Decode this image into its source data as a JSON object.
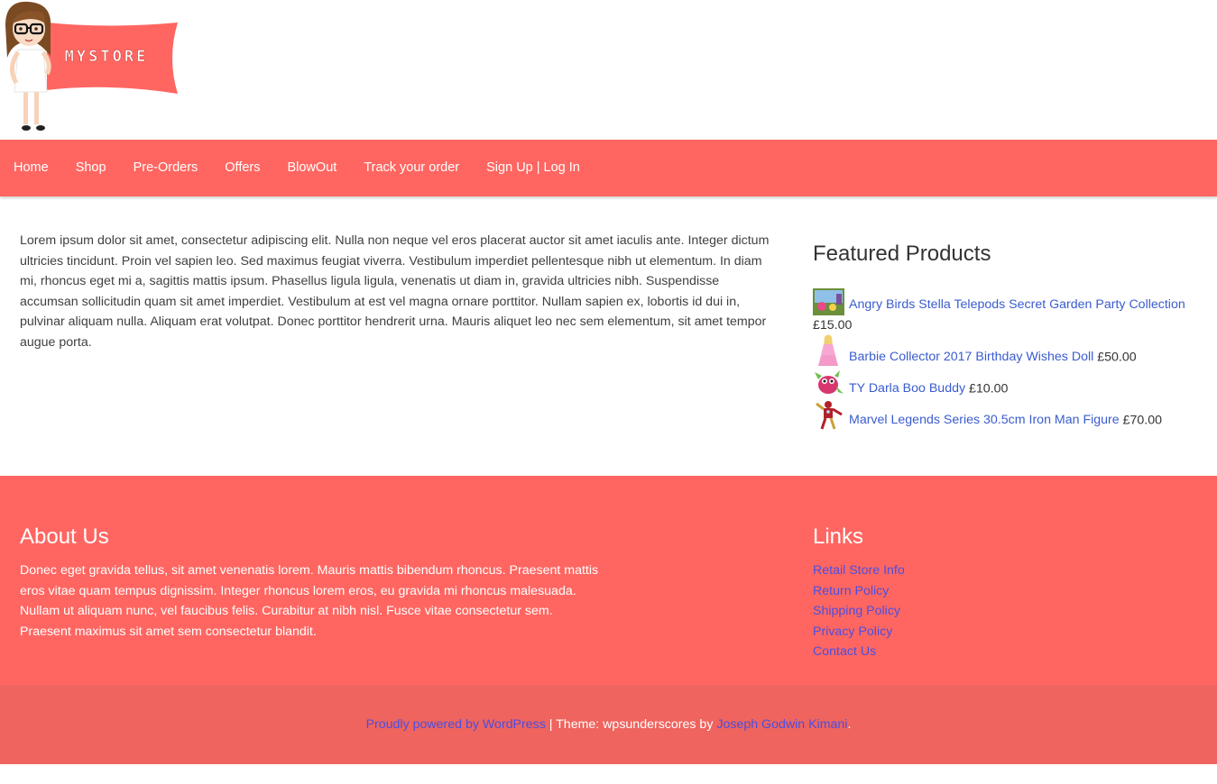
{
  "brand": {
    "logo_text": "MYSTORE",
    "accent": "#ff6661",
    "link_color": "#3a5ccf"
  },
  "nav": {
    "items": [
      {
        "label": "Home"
      },
      {
        "label": "Shop"
      },
      {
        "label": "Pre-Orders"
      },
      {
        "label": "Offers"
      },
      {
        "label": "BlowOut"
      },
      {
        "label": "Track your order"
      },
      {
        "label": "Sign Up | Log In"
      }
    ]
  },
  "main": {
    "intro": "Lorem ipsum dolor sit amet, consectetur adipiscing elit. Nulla non neque vel eros placerat auctor sit amet iaculis ante. Integer dictum ultricies tincidunt. Proin vel sapien leo. Sed maximus feugiat viverra. Vestibulum imperdiet pellentesque nibh ut elementum. In diam mi, rhoncus eget mi a, sagittis mattis ipsum. Phasellus ligula ligula, venenatis ut diam in, gravida ultricies nibh. Suspendisse accumsan sollicitudin quam sit amet imperdiet. Vestibulum at est vel magna ornare porttitor. Nullam sapien ex, lobortis id dui in, pulvinar aliquam nulla. Aliquam erat volutpat. Donec porttitor hendrerit urna. Mauris aliquet leo nec sem elementum, sit amet tempor augue porta."
  },
  "sidebar": {
    "title": "Featured Products",
    "products": [
      {
        "name": "Angry Birds Stella Telepods Secret Garden Party Collection",
        "price": "£15.00",
        "icon": "toy-playset-thumbnail"
      },
      {
        "name": "Barbie Collector 2017 Birthday Wishes Doll",
        "price": "£50.00",
        "icon": "doll-thumbnail"
      },
      {
        "name": "TY Darla Boo Buddy",
        "price": "£10.00",
        "icon": "plush-dragon-thumbnail"
      },
      {
        "name": "Marvel Legends Series 30.5cm Iron Man Figure",
        "price": "£70.00",
        "icon": "action-figure-thumbnail"
      }
    ]
  },
  "footer": {
    "about_title": "About Us",
    "about_text": "Donec eget gravida tellus, sit amet venenatis lorem. Mauris mattis bibendum rhoncus. Praesent mattis eros vitae quam tempus dignissim. Integer rhoncus lorem eros, eu gravida mi rhoncus malesuada. Nullam ut aliquam nunc, vel faucibus felis. Curabitur at nibh nisl. Fusce vitae consectetur sem. Praesent maximus sit amet sem consectetur blandit.",
    "links_title": "Links",
    "links": [
      {
        "label": "Retail Store Info"
      },
      {
        "label": "Return Policy"
      },
      {
        "label": "Shipping Policy"
      },
      {
        "label": "Privacy Policy"
      },
      {
        "label": "Contact Us"
      }
    ]
  },
  "site_info": {
    "powered_by": "Proudly powered by WordPress",
    "separator": " | Theme: wpsunderscores by ",
    "author": "Joseph Godwin Kimani",
    "end": "."
  }
}
